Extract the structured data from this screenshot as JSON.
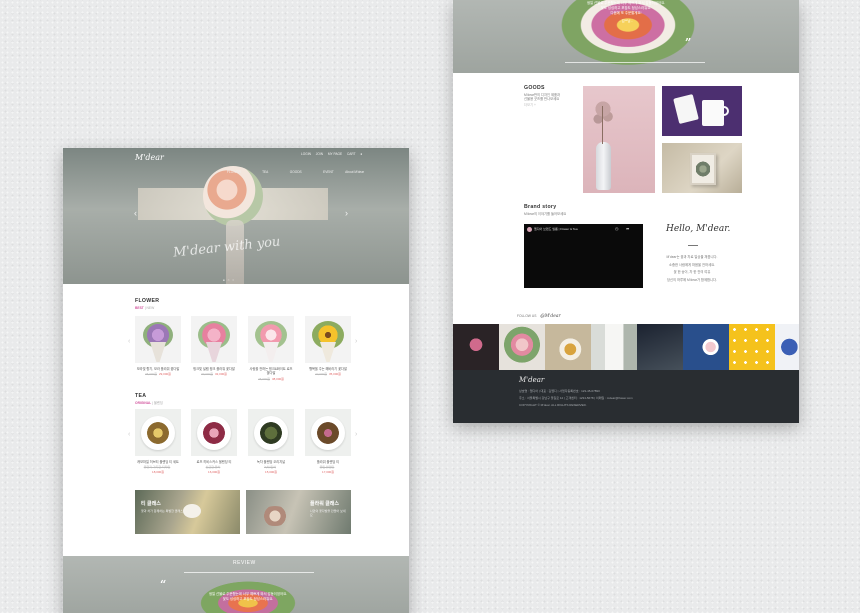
{
  "brand": {
    "logo": "M'dear",
    "hero_script": "M'dear with you"
  },
  "header": {
    "util": [
      "LOGIN",
      "JOIN",
      "MY PAGE",
      "CART"
    ],
    "nav": [
      "FLOWER",
      "TEA",
      "GOODS",
      "EVENT",
      "About M'dear"
    ]
  },
  "flower": {
    "title": "FLOWER",
    "tabs": [
      "BEST",
      "NEW"
    ],
    "products": [
      {
        "name": "보라빛 향기, 보라 플라워 꽃다발",
        "price_old": "35,000원",
        "price": "29,000원"
      },
      {
        "name": "핑크빛 설렘 핑크 플라워 꽃다발",
        "price_old": "39,000원",
        "price": "32,000원"
      },
      {
        "name": "사랑을 전하는 핑크&화이트 로즈 꽃다발",
        "price_old": "45,000원",
        "price": "38,000원"
      },
      {
        "name": "행복을 주는 해바라기 꽃다발",
        "price_old": "42,000원",
        "price": "35,000원"
      }
    ]
  },
  "tea": {
    "title": "TEA",
    "tabs": [
      "ORIGINAL",
      "블렌딩"
    ],
    "products": [
      {
        "name": "캐모마일 허브티 블렌딩 티 세트",
        "sub": "꽃향기 가득한 티타임",
        "price": "18,000원"
      },
      {
        "name": "로즈 히비스커스 블렌딩 티",
        "sub": "상큼한 꽃차",
        "price": "16,000원"
      },
      {
        "name": "녹차 블렌딩 오리지널",
        "sub": "녹차 잎차",
        "price": "15,000원"
      },
      {
        "name": "플라워 블렌딩 티",
        "sub": "꽃잎 블렌딩",
        "price": "17,000원"
      }
    ]
  },
  "banners": [
    {
      "title": "티 클래스",
      "desc": "꽃과 차가 함께하는 특별한 클래스"
    },
    {
      "title": "플라워 클래스",
      "desc": "나만의 꽃다발을 만들어 보세요"
    }
  ],
  "review": {
    "title": "REVIEW",
    "lines": [
      "생일 선물로 주문했는데 너무 예쁘게 와서 감동이었어요.",
      "꽃도 싱싱하고 포장도 정성스러워요.",
      "다음에 또 주문할게요!",
      "- 김**님 -"
    ]
  },
  "goods": {
    "title": "GOODS",
    "desc": [
      "M'dear만의 디자인 제품과",
      "선물용 굿즈를 만나보세요"
    ],
    "more": "더보기 +"
  },
  "brand_story": {
    "title": "Brand story",
    "sub": "M'dear의 이야기를 들어보세요",
    "video_title": "엠디어 브랜드 필름 | Flower & Tea",
    "script_title": "Hello, M'dear.",
    "text": [
      "M'dear는 꽃과 차로 일상을 채웁니다.",
      "소중한 사람에게 마음을 전하세요.",
      "꽃 한 송이, 차 한 잔의 여유",
      "당신의 하루에 M'dear가 함께합니다."
    ]
  },
  "insta": {
    "label": "FOLLOW US",
    "handle": "@M'dear"
  },
  "footer": {
    "logo": "M'dear",
    "lines": [
      "상호명 : 엠디어 | 대표 : 김엠디 | 사업자등록번호 : 123-45-67890",
      "주소 : 서울특별시 강남구 꽃길로 12 | 고객센터 : 1234-5678 | 이메일 : mdear@flower.com",
      "COPYRIGHT © M'dear. ALL RIGHTS RESERVED."
    ]
  },
  "colors": {
    "accent": "#d2569e",
    "footer_bg": "#292d31",
    "hero_bg": "#8f9691"
  }
}
